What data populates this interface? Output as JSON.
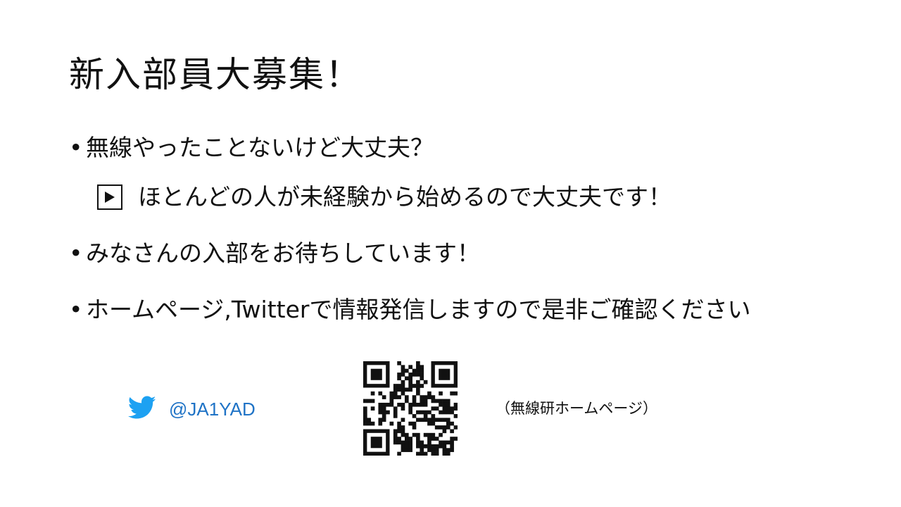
{
  "title": "新入部員大募集！",
  "bullets": {
    "b1": "無線やったことないけど大丈夫？",
    "b1_sub": "ほとんどの人が未経験から始めるので大丈夫です！",
    "b2": "みなさんの入部をお待ちしています！",
    "b3": "ホームページ,Twitterで情報発信しますので是非ご確認ください",
    "bullet_char": "•"
  },
  "twitter": {
    "handle": "@JA1YAD",
    "icon": "twitter-bird-icon",
    "color": "#1DA1F2"
  },
  "qr": {
    "icon": "qr-code",
    "caption": "（無線研ホームページ）"
  }
}
